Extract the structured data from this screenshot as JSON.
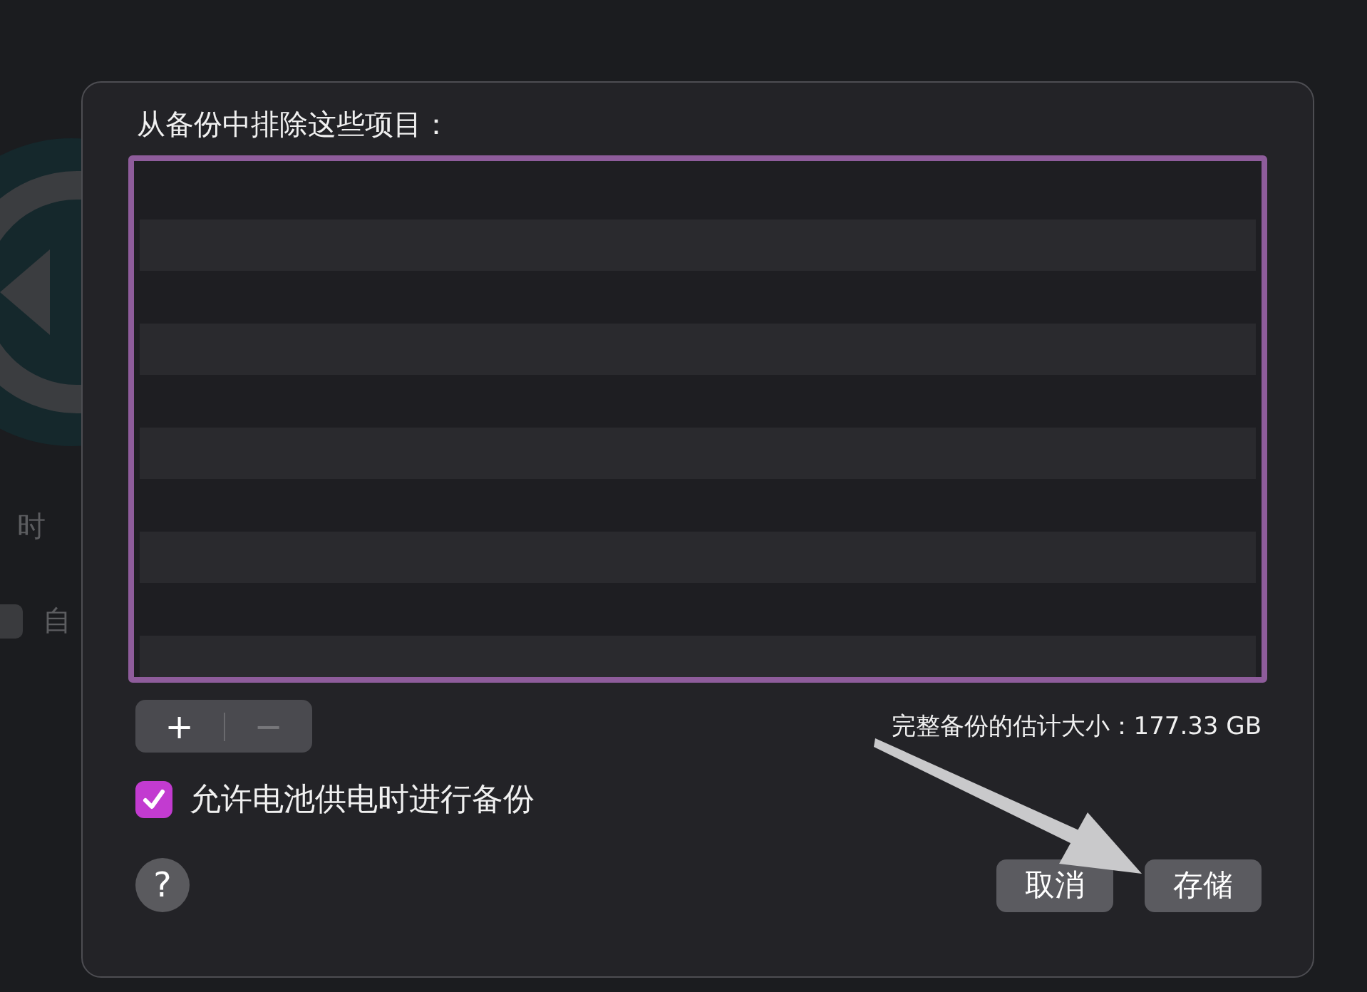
{
  "background_window": {
    "label": "时",
    "checkbox": {
      "label": "自",
      "checked": false
    }
  },
  "dialog": {
    "title": "从备份中排除这些项目：",
    "list_buttons": [
      {
        "label": "+",
        "disabled": false
      },
      {
        "label": "−",
        "disabled": true
      }
    ],
    "estimate": "完整备份的估计大小：177.33 GB",
    "battery_checkbox": {
      "label": "允许电池供电时进行备份",
      "checked": true
    },
    "help": "?",
    "buttons": [
      {
        "label": "取消"
      },
      {
        "label": "存储"
      }
    ]
  }
}
